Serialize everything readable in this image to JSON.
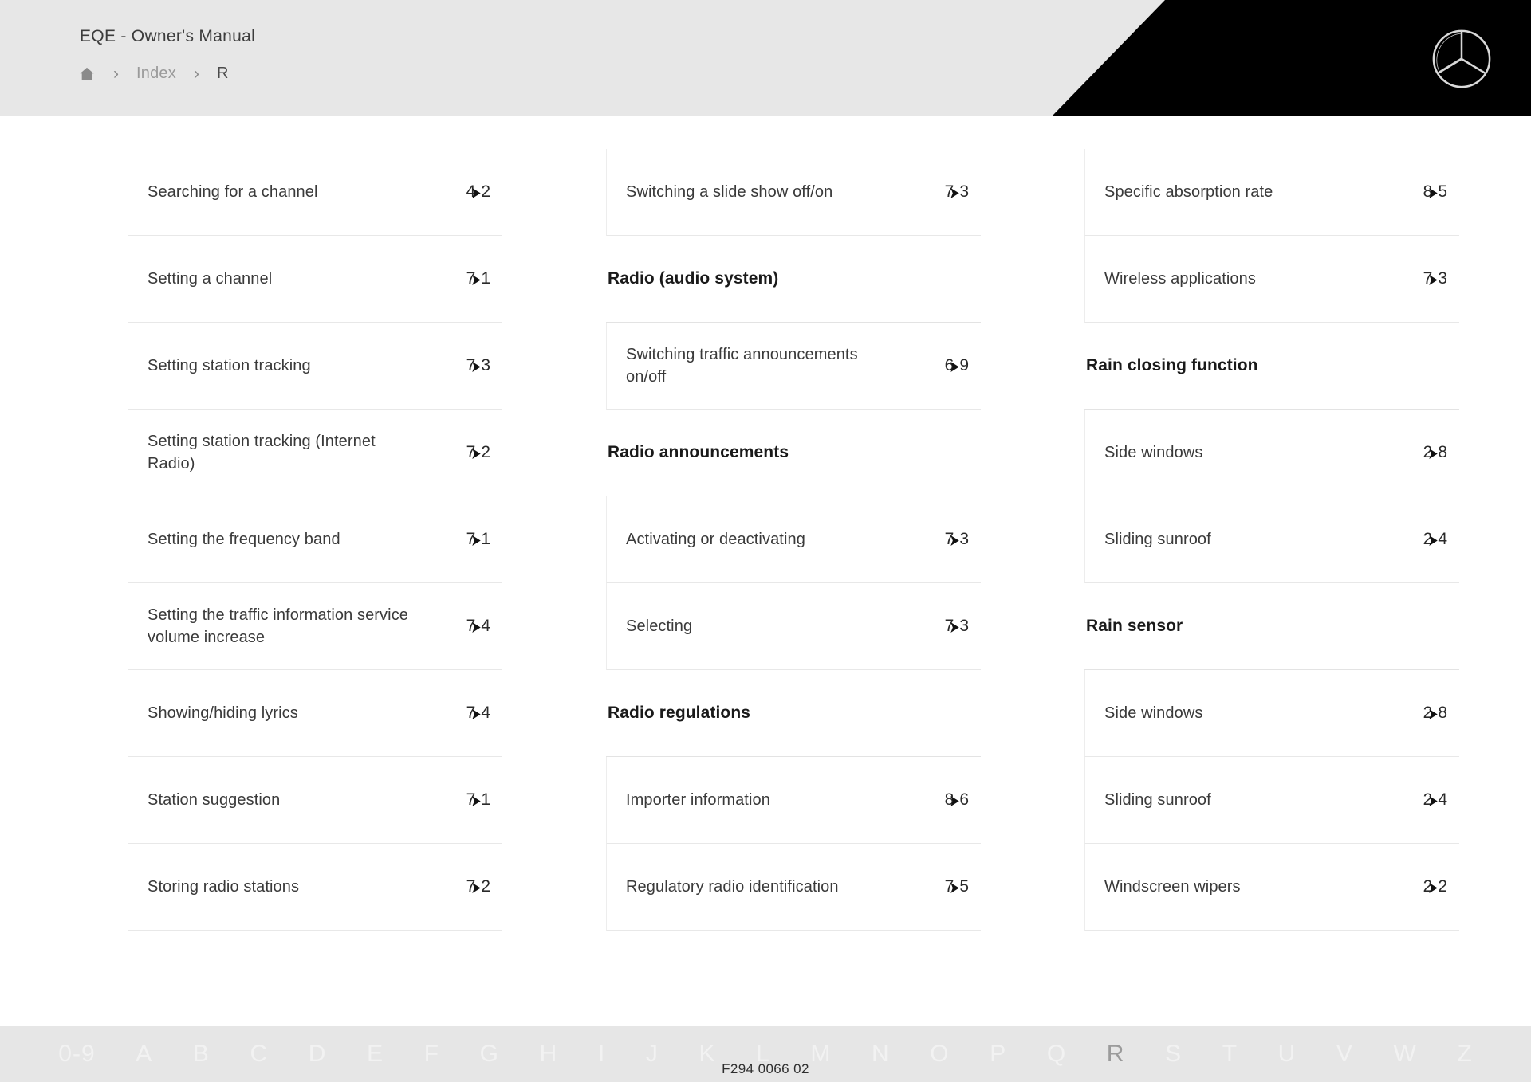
{
  "header": {
    "manual_title": "EQE - Owner's Manual",
    "breadcrumb": {
      "home_icon": "home-icon",
      "separator": "›",
      "items": [
        {
          "label": "Index",
          "current": false
        },
        {
          "label": "R",
          "current": true
        }
      ]
    },
    "brand_logo": "mercedes-benz-star-icon"
  },
  "index": {
    "columns": [
      {
        "blocks": [
          {
            "type": "entries",
            "entries": [
              {
                "label": "Searching for a channel",
                "ref_prefix": "4",
                "ref_icon": "page-reference-arrow-icon",
                "ref_suffix": "2"
              },
              {
                "label": "Setting a channel",
                "ref_prefix": "7",
                "ref_icon": "page-reference-arrow-icon",
                "ref_suffix": "1"
              },
              {
                "label": "Setting station tracking",
                "ref_prefix": "7",
                "ref_icon": "page-reference-arrow-icon",
                "ref_suffix": "3"
              },
              {
                "label": "Setting station tracking (Internet Radio)",
                "ref_prefix": "7",
                "ref_icon": "page-reference-arrow-icon",
                "ref_suffix": "2"
              },
              {
                "label": "Setting the frequency band",
                "ref_prefix": "7",
                "ref_icon": "page-reference-arrow-icon",
                "ref_suffix": "1"
              },
              {
                "label": "Setting the traffic information service volume increase",
                "ref_prefix": "7",
                "ref_icon": "page-reference-arrow-icon",
                "ref_suffix": "4"
              },
              {
                "label": "Showing/hiding lyrics",
                "ref_prefix": "7",
                "ref_icon": "page-reference-arrow-icon",
                "ref_suffix": "4"
              },
              {
                "label": "Station suggestion",
                "ref_prefix": "7",
                "ref_icon": "page-reference-arrow-icon",
                "ref_suffix": "1"
              },
              {
                "label": "Storing radio stations",
                "ref_prefix": "7",
                "ref_icon": "page-reference-arrow-icon",
                "ref_suffix": "2"
              }
            ]
          }
        ]
      },
      {
        "blocks": [
          {
            "type": "entries",
            "entries": [
              {
                "label": "Switching a slide show off/on",
                "ref_prefix": "7",
                "ref_icon": "page-reference-arrow-icon",
                "ref_suffix": "3"
              }
            ]
          },
          {
            "type": "title",
            "title": "Radio (audio system)"
          },
          {
            "type": "entries",
            "entries": [
              {
                "label": "Switching traffic announcements on/off",
                "ref_prefix": "6",
                "ref_icon": "page-reference-arrow-icon",
                "ref_suffix": "9"
              }
            ]
          },
          {
            "type": "title",
            "title": "Radio announcements"
          },
          {
            "type": "entries",
            "entries": [
              {
                "label": "Activating or deactivating",
                "ref_prefix": "7",
                "ref_icon": "page-reference-arrow-icon",
                "ref_suffix": "3"
              },
              {
                "label": "Selecting",
                "ref_prefix": "7",
                "ref_icon": "page-reference-arrow-icon",
                "ref_suffix": "3"
              }
            ]
          },
          {
            "type": "title",
            "title": "Radio regulations"
          },
          {
            "type": "entries",
            "entries": [
              {
                "label": "Importer information",
                "ref_prefix": "8",
                "ref_icon": "page-reference-arrow-icon",
                "ref_suffix": "6"
              },
              {
                "label": "Regulatory radio identification",
                "ref_prefix": "7",
                "ref_icon": "page-reference-arrow-icon",
                "ref_suffix": "5"
              }
            ]
          }
        ]
      },
      {
        "blocks": [
          {
            "type": "entries",
            "entries": [
              {
                "label": "Specific absorption rate",
                "ref_prefix": "8",
                "ref_icon": "page-reference-arrow-icon",
                "ref_suffix": "5"
              },
              {
                "label": "Wireless applications",
                "ref_prefix": "7",
                "ref_icon": "page-reference-arrow-icon",
                "ref_suffix": "3"
              }
            ]
          },
          {
            "type": "title",
            "title": "Rain closing function"
          },
          {
            "type": "entries",
            "entries": [
              {
                "label": "Side windows",
                "ref_prefix": "2",
                "ref_icon": "page-reference-arrow-icon",
                "ref_suffix": "8"
              },
              {
                "label": "Sliding sunroof",
                "ref_prefix": "2",
                "ref_icon": "page-reference-arrow-icon",
                "ref_suffix": "4"
              }
            ]
          },
          {
            "type": "title",
            "title": "Rain sensor"
          },
          {
            "type": "entries",
            "entries": [
              {
                "label": "Side windows",
                "ref_prefix": "2",
                "ref_icon": "page-reference-arrow-icon",
                "ref_suffix": "8"
              },
              {
                "label": "Sliding sunroof",
                "ref_prefix": "2",
                "ref_icon": "page-reference-arrow-icon",
                "ref_suffix": "4"
              },
              {
                "label": "Windscreen wipers",
                "ref_prefix": "2",
                "ref_icon": "page-reference-arrow-icon",
                "ref_suffix": "2"
              }
            ]
          }
        ]
      }
    ]
  },
  "alphabet_bar": {
    "letters": [
      {
        "label": "0-9",
        "active": false
      },
      {
        "label": "A",
        "active": false
      },
      {
        "label": "B",
        "active": false
      },
      {
        "label": "C",
        "active": false
      },
      {
        "label": "D",
        "active": false
      },
      {
        "label": "E",
        "active": false
      },
      {
        "label": "F",
        "active": false
      },
      {
        "label": "G",
        "active": false
      },
      {
        "label": "H",
        "active": false
      },
      {
        "label": "I",
        "active": false
      },
      {
        "label": "J",
        "active": false
      },
      {
        "label": "K",
        "active": false
      },
      {
        "label": "L",
        "active": false
      },
      {
        "label": "M",
        "active": false
      },
      {
        "label": "N",
        "active": false
      },
      {
        "label": "O",
        "active": false
      },
      {
        "label": "P",
        "active": false
      },
      {
        "label": "Q",
        "active": false
      },
      {
        "label": "R",
        "active": true
      },
      {
        "label": "S",
        "active": false
      },
      {
        "label": "T",
        "active": false
      },
      {
        "label": "U",
        "active": false
      },
      {
        "label": "V",
        "active": false
      },
      {
        "label": "W",
        "active": false
      },
      {
        "label": "Z",
        "active": false
      }
    ]
  },
  "document_code": "F294 0066 02",
  "colors": {
    "header_bg": "#e7e7e7",
    "header_accent": "#000000",
    "page_bg": "#ffffff",
    "text": "#3a3a3a",
    "heading": "#1a1a1a",
    "muted": "#9a9a9a",
    "rule": "#e8e8e8",
    "alpha_bar_bg": "#e6e6e6",
    "alpha_letter": "#f2f2f2",
    "alpha_letter_active": "#9b9b9b"
  }
}
